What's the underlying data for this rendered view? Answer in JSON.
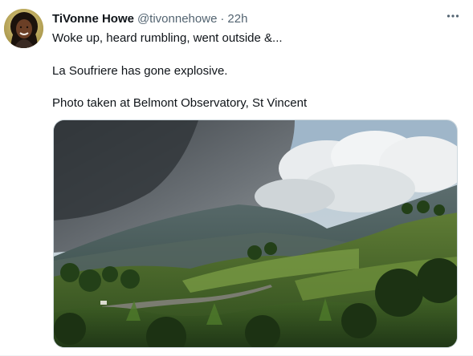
{
  "tweet": {
    "author": {
      "display_name": "TiVonne Howe",
      "handle": "@tivonnehowe"
    },
    "separator": "·",
    "timestamp": "22h",
    "more_icon": "more-horizontal-icon",
    "text": {
      "line1": "Woke up, heard rumbling, went outside &...",
      "line2": "La Soufriere has gone explosive.",
      "line3": "Photo taken at Belmont Observatory, St Vincent"
    },
    "media": {
      "kind": "photo"
    }
  },
  "colors": {
    "text_primary": "#0f1419",
    "text_secondary": "#536471",
    "border": "#cfd9de",
    "background": "#ffffff"
  }
}
